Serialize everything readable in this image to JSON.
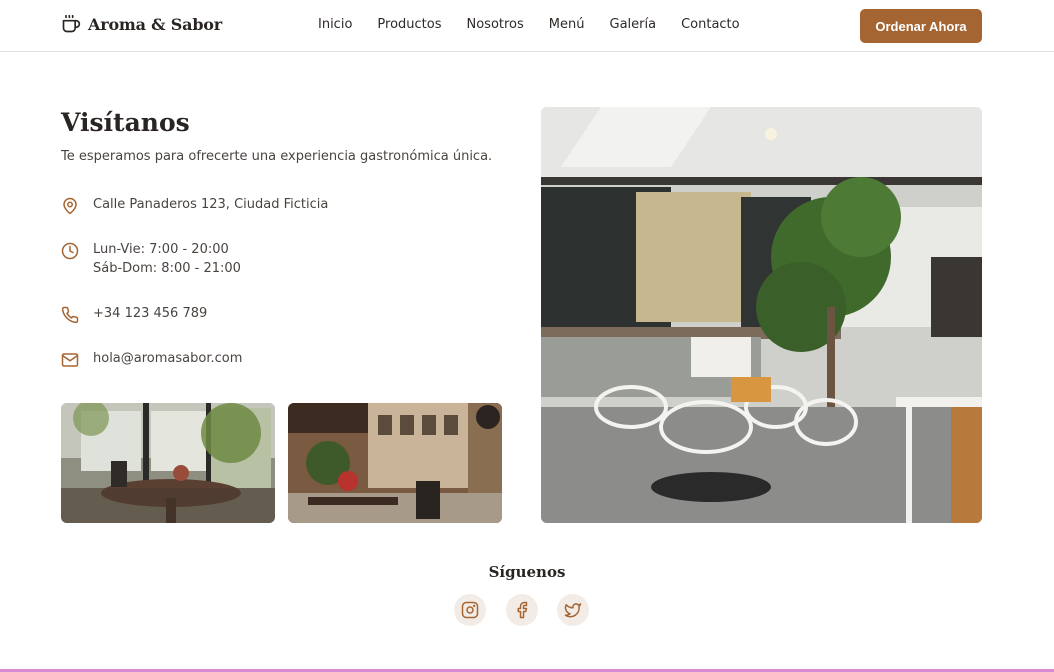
{
  "brand": {
    "name": "Aroma & Sabor",
    "logo_icon": "coffee-cup-icon"
  },
  "nav": {
    "items": [
      "Inicio",
      "Productos",
      "Nosotros",
      "Menú",
      "Galería",
      "Contacto"
    ]
  },
  "cta": {
    "label": "Ordenar Ahora"
  },
  "visit": {
    "title": "Visítanos",
    "subtitle": "Te esperamos para ofrecerte una experiencia gastronómica única.",
    "address": "Calle Panaderos 123, Ciudad Ficticia",
    "hours_weekday": "Lun-Vie: 7:00 - 20:00",
    "hours_weekend": "Sáb-Dom: 8:00 - 21:00",
    "phone": "+34 123 456 789",
    "email": "hola@aromasabor.com"
  },
  "follow": {
    "title": "Síguenos",
    "icons": [
      "instagram-icon",
      "facebook-icon",
      "twitter-icon"
    ]
  },
  "colors": {
    "accent": "#a56532",
    "text_dark": "#2a2522",
    "text_body": "#4a4440",
    "social_bg": "#f3ece6"
  }
}
